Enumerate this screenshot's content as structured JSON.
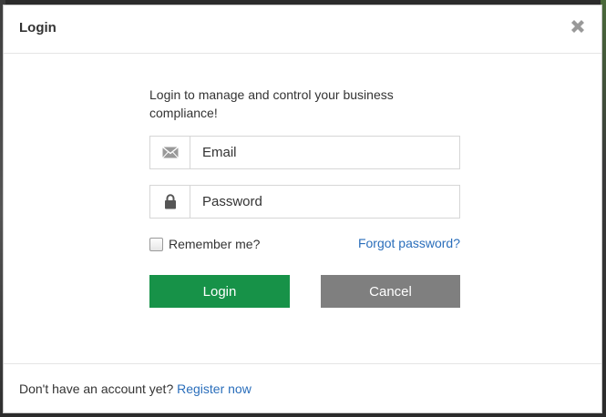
{
  "modal": {
    "title": "Login",
    "close_icon": "close-icon"
  },
  "form": {
    "intro": "Login to manage and control your business compliance!",
    "email": {
      "placeholder": "Email",
      "value": "",
      "icon": "envelope-icon"
    },
    "password": {
      "placeholder": "Password",
      "value": "",
      "icon": "lock-icon"
    },
    "remember_label": "Remember me?",
    "remember_checked": false,
    "forgot_label": "Forgot password?",
    "login_label": "Login",
    "cancel_label": "Cancel"
  },
  "footer": {
    "prompt": "Don't have an account yet?",
    "register_label": "Register now"
  },
  "colors": {
    "login_button": "#179248",
    "cancel_button": "#7f7f7f",
    "link": "#2a6ebb"
  }
}
